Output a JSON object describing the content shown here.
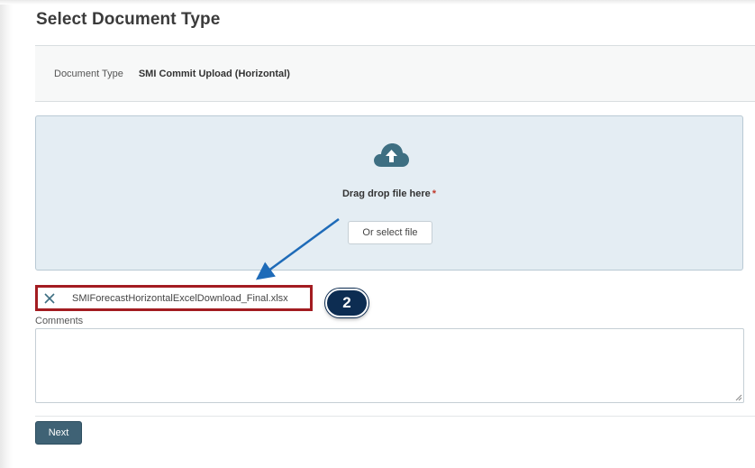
{
  "page": {
    "title": "Select Document Type"
  },
  "document_type": {
    "label": "Document Type",
    "value": "SMI Commit Upload (Horizontal)"
  },
  "dropzone": {
    "icon": "cloud-upload-icon",
    "prompt": "Drag drop file here",
    "required_marker": "*",
    "select_button_label": "Or select file"
  },
  "selected_file": {
    "name": "SMIForecastHorizontalExcelDownload_Final.xlsx",
    "remove_icon": "close-icon"
  },
  "annotation": {
    "step_number": "2",
    "highlight_color": "#a31c21",
    "arrow_color": "#1e6bb8",
    "badge_color": "#0d2d52"
  },
  "comments": {
    "label": "Comments",
    "value": ""
  },
  "actions": {
    "next_label": "Next"
  },
  "colors": {
    "accent": "#3f6275",
    "dropzone_bg": "#e4edf3",
    "icon": "#3e6f82"
  }
}
